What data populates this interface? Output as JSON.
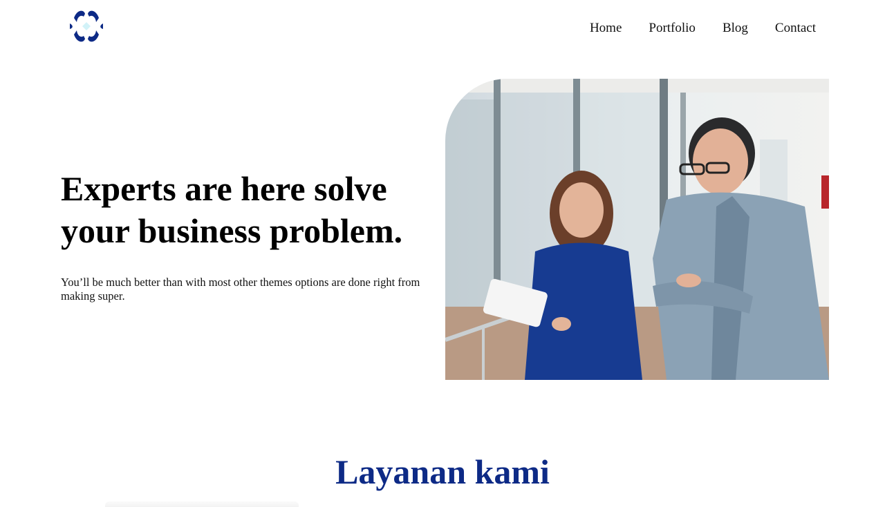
{
  "header": {
    "logo_icon": "four-petal-logo-icon",
    "nav": [
      {
        "label": "Home"
      },
      {
        "label": "Portfolio"
      },
      {
        "label": "Blog"
      },
      {
        "label": "Contact"
      }
    ]
  },
  "hero": {
    "title": "Experts are here solve your business problem.",
    "text": "You’ll be much better than with most other themes options are done right from making super.",
    "image": "photo-two-colleagues-reviewing-document-in-office"
  },
  "services": {
    "title": "Layanan kami"
  },
  "colors": {
    "brand": "#0d2a86",
    "brand_light": "#7fd9ea"
  }
}
